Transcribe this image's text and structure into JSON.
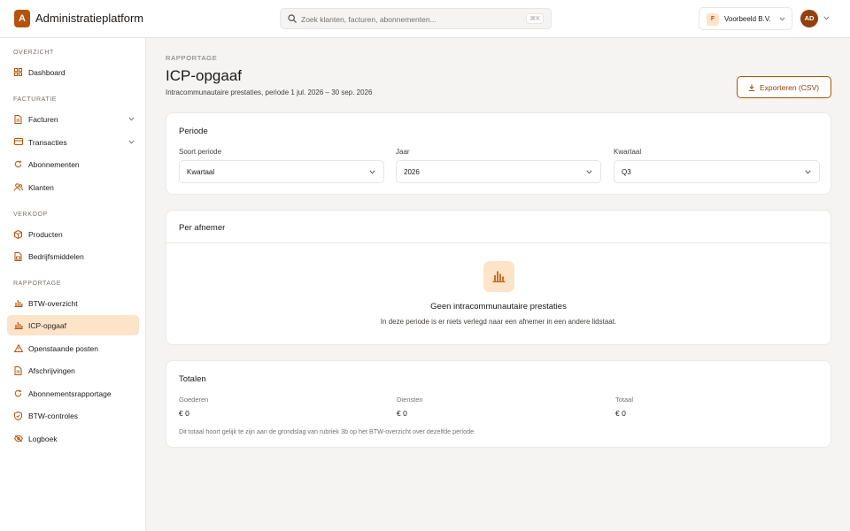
{
  "app": {
    "logo_letter": "A",
    "title": "Administratieplatform"
  },
  "search": {
    "placeholder": "Zoek klanten, facturen, abonnementen...",
    "shortcut": "⌘K"
  },
  "org": {
    "badge": "F",
    "name": "Voorbeeld B.V."
  },
  "user": {
    "initials": "AD"
  },
  "colors": {
    "accent": "#b45309",
    "accent_soft": "#fde3c8",
    "active_bg": "#fde3c8"
  },
  "sidebar": {
    "sections": [
      {
        "label": "OVERZICHT",
        "items": [
          {
            "label": "Dashboard",
            "icon": "grid-icon"
          }
        ]
      },
      {
        "label": "FACTURATIE",
        "items": [
          {
            "label": "Facturen",
            "icon": "document-icon",
            "expandable": true
          },
          {
            "label": "Transacties",
            "icon": "credit-card-icon",
            "expandable": true
          },
          {
            "label": "Abonnementen",
            "icon": "refresh-icon"
          },
          {
            "label": "Klanten",
            "icon": "users-icon"
          }
        ]
      },
      {
        "label": "VERKOOP",
        "items": [
          {
            "label": "Producten",
            "icon": "box-icon"
          },
          {
            "label": "Bedrijfsmiddelen",
            "icon": "asset-icon"
          }
        ]
      },
      {
        "label": "RAPPORTAGE",
        "items": [
          {
            "label": "BTW-overzicht",
            "icon": "bar-chart-icon"
          },
          {
            "label": "ICP-opgaaf",
            "icon": "bar-chart-icon",
            "active": true
          },
          {
            "label": "Openstaande posten",
            "icon": "warning-icon"
          },
          {
            "label": "Afschrijvingen",
            "icon": "document-icon"
          },
          {
            "label": "Abonnementsrapportage",
            "icon": "refresh-icon"
          },
          {
            "label": "BTW-controles",
            "icon": "shield-check-icon"
          },
          {
            "label": "Logboek",
            "icon": "eye-off-icon"
          }
        ]
      }
    ]
  },
  "page": {
    "eyebrow": "RAPPORTAGE",
    "title": "ICP-opgaaf",
    "subtitle": "Intracommunautaire prestaties, periode 1 jul. 2026 – 30 sep. 2026",
    "export_label": "Exporteren (CSV)"
  },
  "period_card": {
    "title": "Periode",
    "fields": [
      {
        "label": "Soort periode",
        "value": "Kwartaal"
      },
      {
        "label": "Jaar",
        "value": "2026"
      },
      {
        "label": "Kwartaal",
        "value": "Q3"
      }
    ]
  },
  "customers_card": {
    "title": "Per afnemer",
    "empty_title": "Geen intracommunautaire prestaties",
    "empty_desc": "In deze periode is er niets verlegd naar een afnemer in een andere lidstaat."
  },
  "totals_card": {
    "title": "Totalen",
    "items": [
      {
        "label": "Goederen",
        "value": "€ 0"
      },
      {
        "label": "Diensten",
        "value": "€ 0"
      },
      {
        "label": "Totaal",
        "value": "€ 0"
      }
    ],
    "note": "Dit totaal hoort gelijk te zijn aan de grondslag van rubriek 3b op het BTW-overzicht over dezelfde periode."
  }
}
